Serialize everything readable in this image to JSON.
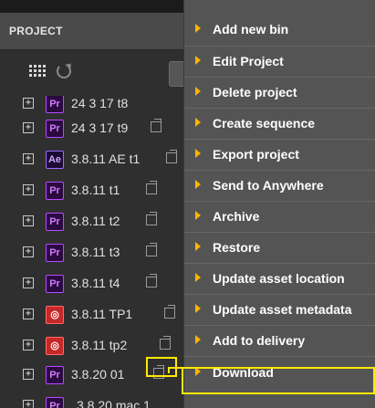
{
  "panel": {
    "title": "PROJECT"
  },
  "toolbar": {
    "view_icon": "grid-icon",
    "refresh_icon": "refresh-icon"
  },
  "projects": [
    {
      "label": "24 3 17 t8",
      "app": "Pr"
    },
    {
      "label": "24 3 17 t9",
      "app": "Pr"
    },
    {
      "label": "3.8.11 AE t1",
      "app": "Ae"
    },
    {
      "label": "3.8.11 t1",
      "app": "Pr"
    },
    {
      "label": "3.8.11 t2",
      "app": "Pr"
    },
    {
      "label": "3.8.11 t3",
      "app": "Pr"
    },
    {
      "label": "3.8.11 t4",
      "app": "Pr"
    },
    {
      "label": "3.8.11 TP1",
      "app": "TP"
    },
    {
      "label": "3.8.11 tp2",
      "app": "TP"
    },
    {
      "label": "3.8.20 01",
      "app": "Pr"
    },
    {
      "label": "3.8.20 mac 1",
      "app": "Pr"
    }
  ],
  "context_menu": {
    "items": [
      "Add new bin",
      "Edit Project",
      "Delete project",
      "Create sequence",
      "Export project",
      "Send to Anywhere",
      "Archive",
      "Restore",
      "Update asset location",
      "Update asset metadata",
      "Add to delivery",
      "Download"
    ],
    "highlight_color": "#ffea00",
    "bullet_color": "#ffb300"
  }
}
